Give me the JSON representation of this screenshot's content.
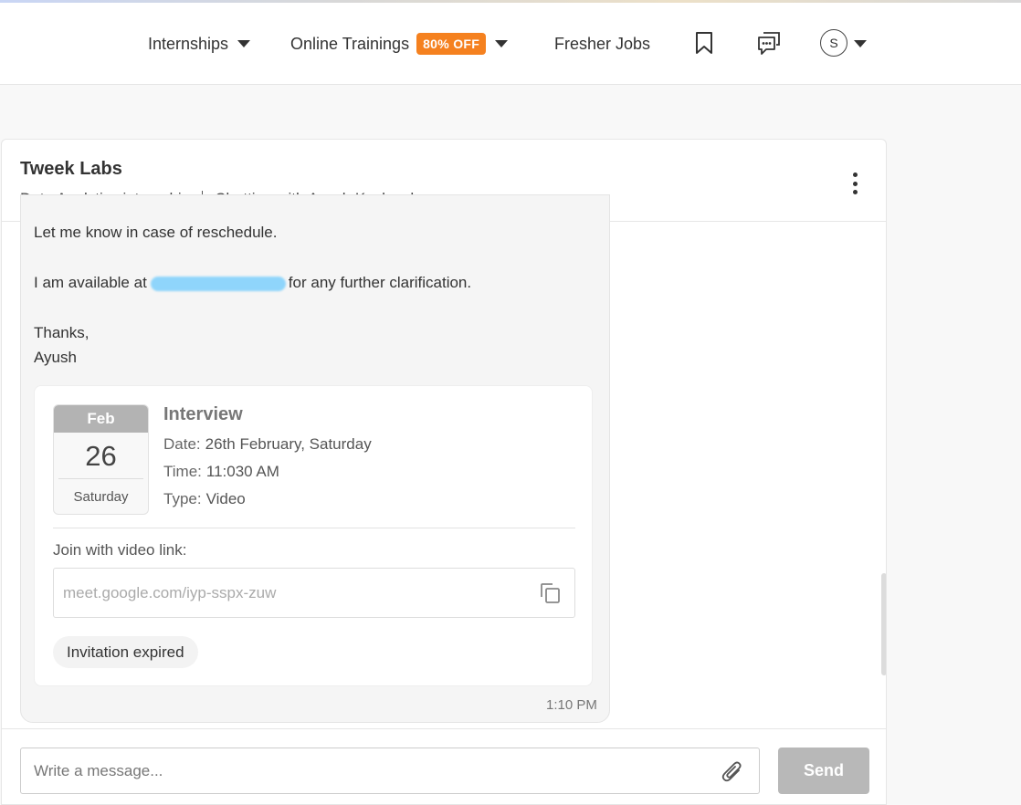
{
  "nav": {
    "internships": "Internships",
    "online_trainings": "Online Trainings",
    "discount_badge": "80% OFF",
    "fresher_jobs": "Fresher Jobs",
    "avatar_initial": "S",
    "bookmark_icon": "bookmark-icon",
    "chat_icon": "chat-bubbles-icon"
  },
  "chat_header": {
    "company": "Tweek Labs",
    "internship": "Data Analytics internship",
    "chatting_with": "Chatting with Ayush Kushwaha"
  },
  "message": {
    "line1": "Let me know in case of reschedule.",
    "available_prefix": "I am available at",
    "available_suffix": "for any further clarification.",
    "thanks": "Thanks,",
    "signature": "Ayush",
    "time": "1:10 PM"
  },
  "interview": {
    "calendar_month": "Feb",
    "calendar_day": "26",
    "calendar_weekday": "Saturday",
    "title": "Interview",
    "date_label": "Date:",
    "date_value": "26th February, Saturday",
    "time_label": "Time:",
    "time_value": "11:030 AM",
    "type_label": "Type:",
    "type_value": "Video",
    "join_label": "Join with video link:",
    "video_link": "meet.google.com/iyp-sspx-zuw",
    "status": "Invitation expired"
  },
  "composer": {
    "placeholder": "Write a message...",
    "send_label": "Send"
  },
  "colors": {
    "badge": "#f5811f",
    "send_disabled": "#b8b8b8",
    "redaction": "#8fd5fb"
  }
}
